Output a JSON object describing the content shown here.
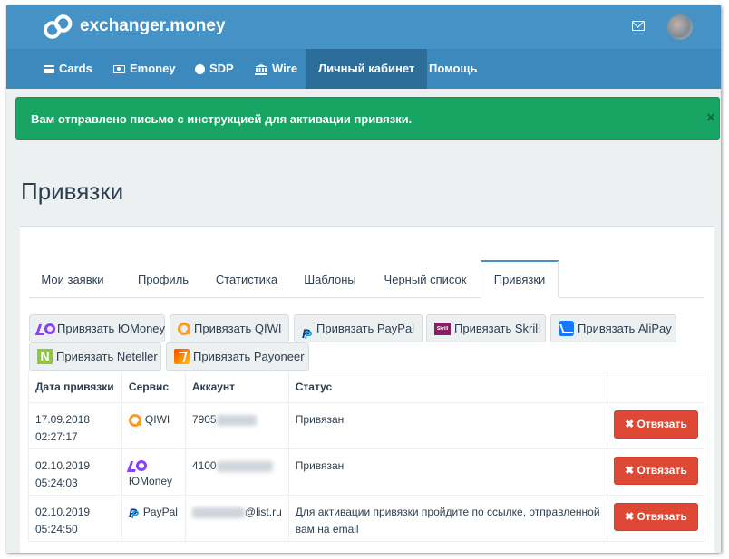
{
  "header": {
    "brand": "exchanger.money"
  },
  "nav": [
    {
      "label": "Cards",
      "icon": "card-icon"
    },
    {
      "label": "Emoney",
      "icon": "money-icon"
    },
    {
      "label": "SDP",
      "icon": "globe-icon"
    },
    {
      "label": "Wire",
      "icon": "bank-icon"
    },
    {
      "label": "Личный кабинет",
      "active": true
    },
    {
      "label": "Помощь"
    }
  ],
  "alert": {
    "text": "Вам отправлено письмо с инструкцией для активации привязки.",
    "close": "×",
    "color": "#18a563"
  },
  "page": {
    "title": "Привязки"
  },
  "tabs": [
    {
      "label": "Мои заявки"
    },
    {
      "label": "Профиль"
    },
    {
      "label": "Статистика"
    },
    {
      "label": "Шаблоны"
    },
    {
      "label": "Черный список"
    },
    {
      "label": "Привязки",
      "active": true
    }
  ],
  "link_buttons": [
    {
      "label": "Привязать ЮMoney",
      "icon": "yoomoney-icon"
    },
    {
      "label": "Привязать QIWI",
      "icon": "qiwi-icon"
    },
    {
      "label": "Привязать PayPal",
      "icon": "paypal-icon"
    },
    {
      "label": "Привязать Skrill",
      "icon": "skrill-icon",
      "icon_text": "Skrill"
    },
    {
      "label": "Привязать AliPay",
      "icon": "alipay-icon"
    },
    {
      "label": "Привязать Neteller",
      "icon": "neteller-icon",
      "icon_text": "N"
    },
    {
      "label": "Привязать Payoneer",
      "icon": "payoneer-icon"
    }
  ],
  "table": {
    "headers": [
      "Дата привязки",
      "Сервис",
      "Аккаунт",
      "Статус",
      ""
    ],
    "rows": [
      {
        "date": "17.09.2018",
        "time": "02:27:17",
        "service": "QIWI",
        "service_icon": "qiwi-icon",
        "account_prefix": "7905",
        "account_suffix": "",
        "status": "Привязан",
        "action": "✖ Отвязать"
      },
      {
        "date": "02.10.2019",
        "time": "05:24:03",
        "service": "ЮMoney",
        "service_icon": "yoomoney-icon",
        "account_prefix": "4100",
        "account_suffix": "",
        "status": "Привязан",
        "action": "✖ Отвязать"
      },
      {
        "date": "02.10.2019",
        "time": "05:24:50",
        "service": "PayPal",
        "service_icon": "paypal-icon",
        "account_prefix": "",
        "account_suffix": "@list.ru",
        "status": "Для активации привязки пройдите по ссылке, отправленной вам на email",
        "action": "✖ Отвязать"
      }
    ]
  },
  "colors": {
    "header": "#4592c6",
    "navbar": "#3c89bd",
    "nav_active": "#2d6d99",
    "danger": "#e04836"
  }
}
